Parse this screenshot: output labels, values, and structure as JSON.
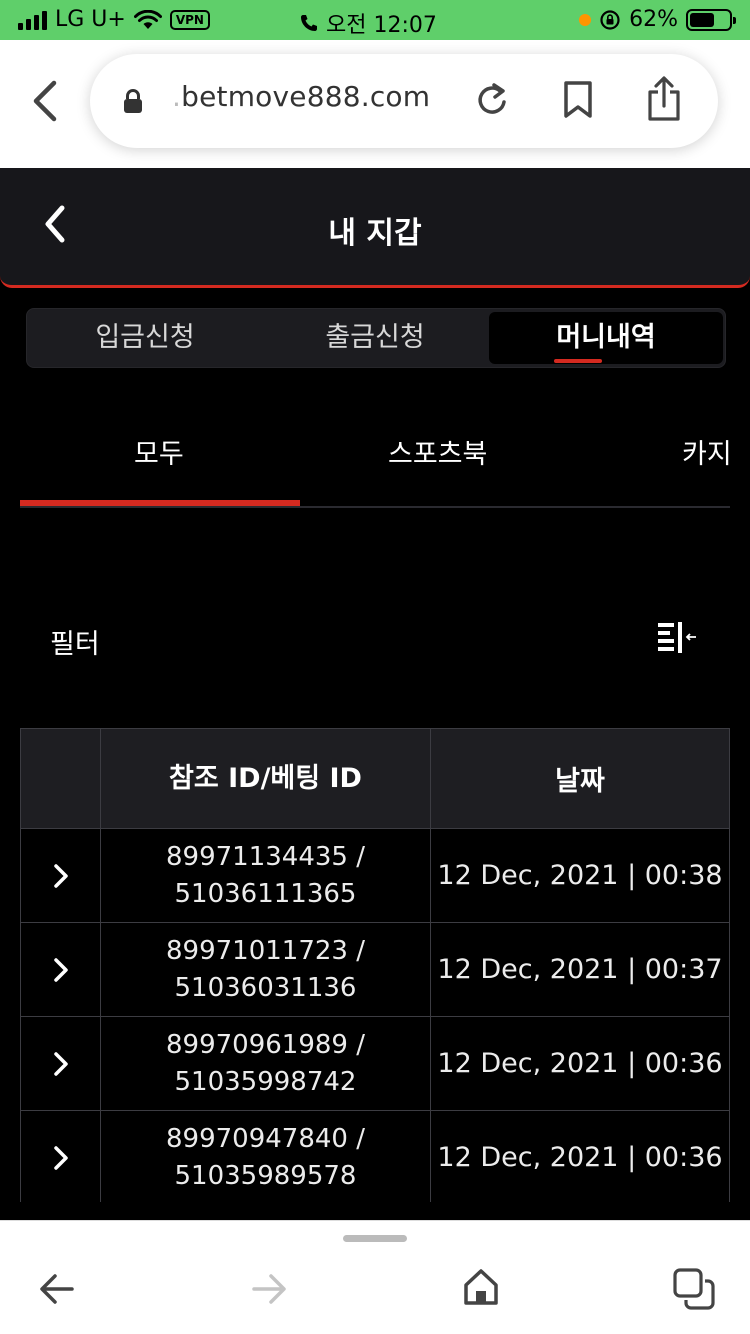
{
  "status_bar": {
    "carrier": "LG U+",
    "vpn": "VPN",
    "time": "오전 12:07",
    "battery": "62%",
    "battery_level": 0.62
  },
  "browser": {
    "url_faded": ".",
    "url_main": "betmove888.com"
  },
  "header": {
    "title": "내 지갑"
  },
  "segment_tabs": [
    {
      "label": "입금신청",
      "active": false
    },
    {
      "label": "출금신청",
      "active": false
    },
    {
      "label": "머니내역",
      "active": true
    }
  ],
  "category_tabs": [
    {
      "label": "모두",
      "active": true
    },
    {
      "label": "스포츠북",
      "active": false
    },
    {
      "label": "카지",
      "active": false
    }
  ],
  "filter": {
    "label": "필터"
  },
  "table": {
    "columns": [
      "",
      "참조 ID/베팅 ID",
      "날짜"
    ],
    "rows": [
      {
        "ref_id": "89971134435 /",
        "bet_id": "51036111365",
        "date": "12 Dec, 2021 | 00:38"
      },
      {
        "ref_id": "89971011723 /",
        "bet_id": "51036031136",
        "date": "12 Dec, 2021 | 00:37"
      },
      {
        "ref_id": "89970961989 /",
        "bet_id": "51035998742",
        "date": "12 Dec, 2021 | 00:36"
      },
      {
        "ref_id": "89970947840 /",
        "bet_id": "51035989578",
        "date": "12 Dec, 2021 | 00:36"
      }
    ]
  },
  "colors": {
    "status_bar_bg": "#5fcf6a",
    "accent": "#d42a20",
    "header_bg": "#17171b",
    "page_bg": "#000000"
  }
}
